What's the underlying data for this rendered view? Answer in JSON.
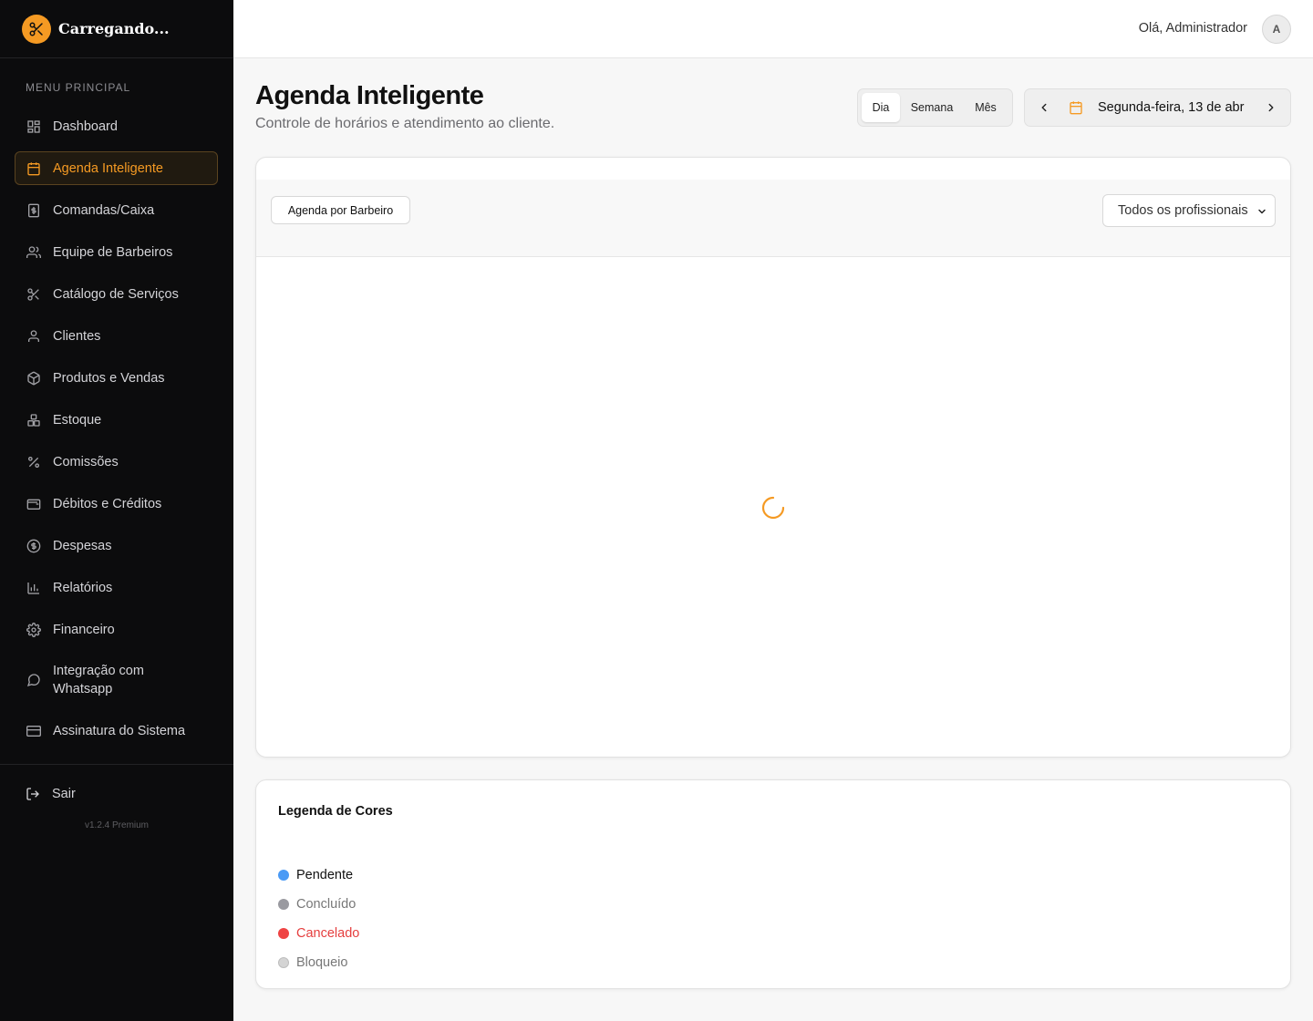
{
  "brand": {
    "name": "Carregando...",
    "logo_icon": "scissors-icon",
    "accent": "#f59a23"
  },
  "sidebar": {
    "section_title": "MENU PRINCIPAL",
    "items": [
      {
        "label": "Dashboard",
        "icon": "dashboard-icon"
      },
      {
        "label": "Agenda Inteligente",
        "icon": "calendar-icon",
        "active": true
      },
      {
        "label": "Comandas/Caixa",
        "icon": "receipt-icon"
      },
      {
        "label": "Equipe de Barbeiros",
        "icon": "users-icon"
      },
      {
        "label": "Catálogo de Serviços",
        "icon": "scissors-icon"
      },
      {
        "label": "Clientes",
        "icon": "user-icon"
      },
      {
        "label": "Produtos e Vendas",
        "icon": "package-icon"
      },
      {
        "label": "Estoque",
        "icon": "boxes-icon"
      },
      {
        "label": "Comissões",
        "icon": "percent-icon"
      },
      {
        "label": "Débitos e Créditos",
        "icon": "wallet-icon"
      },
      {
        "label": "Despesas",
        "icon": "dollar-circle-icon"
      },
      {
        "label": "Relatórios",
        "icon": "bar-chart-icon"
      },
      {
        "label": "Financeiro",
        "icon": "gear-icon"
      },
      {
        "label": "Integração com Whatsapp",
        "icon": "chat-icon"
      },
      {
        "label": "Assinatura do Sistema",
        "icon": "credit-card-icon"
      }
    ],
    "logout_label": "Sair",
    "version": "v1.2.4 Premium"
  },
  "header": {
    "greeting": "Olá, Administrador",
    "avatar_initial": "A"
  },
  "page": {
    "title": "Agenda Inteligente",
    "subtitle": "Controle de horários e atendimento ao cliente."
  },
  "view_toggle": {
    "options": [
      "Dia",
      "Semana",
      "Mês"
    ],
    "selected": "Dia"
  },
  "date_nav": {
    "label": "Segunda-feira, 13 de abr"
  },
  "toolbar": {
    "by_barber_label": "Agenda por Barbeiro",
    "professional_select": {
      "value": "Todos os profissionais"
    }
  },
  "legend": {
    "title": "Legenda de Cores",
    "items": [
      {
        "label": "Pendente",
        "color": "#4a9af5",
        "text_color": "#111111"
      },
      {
        "label": "Concluído",
        "color": "#9a9aa0",
        "text_color": "#777777"
      },
      {
        "label": "Cancelado",
        "color": "#ef4444",
        "text_color": "#e53e3e"
      },
      {
        "label": "Bloqueio",
        "color": "#d4d4d4",
        "text_color": "#777777"
      }
    ]
  }
}
